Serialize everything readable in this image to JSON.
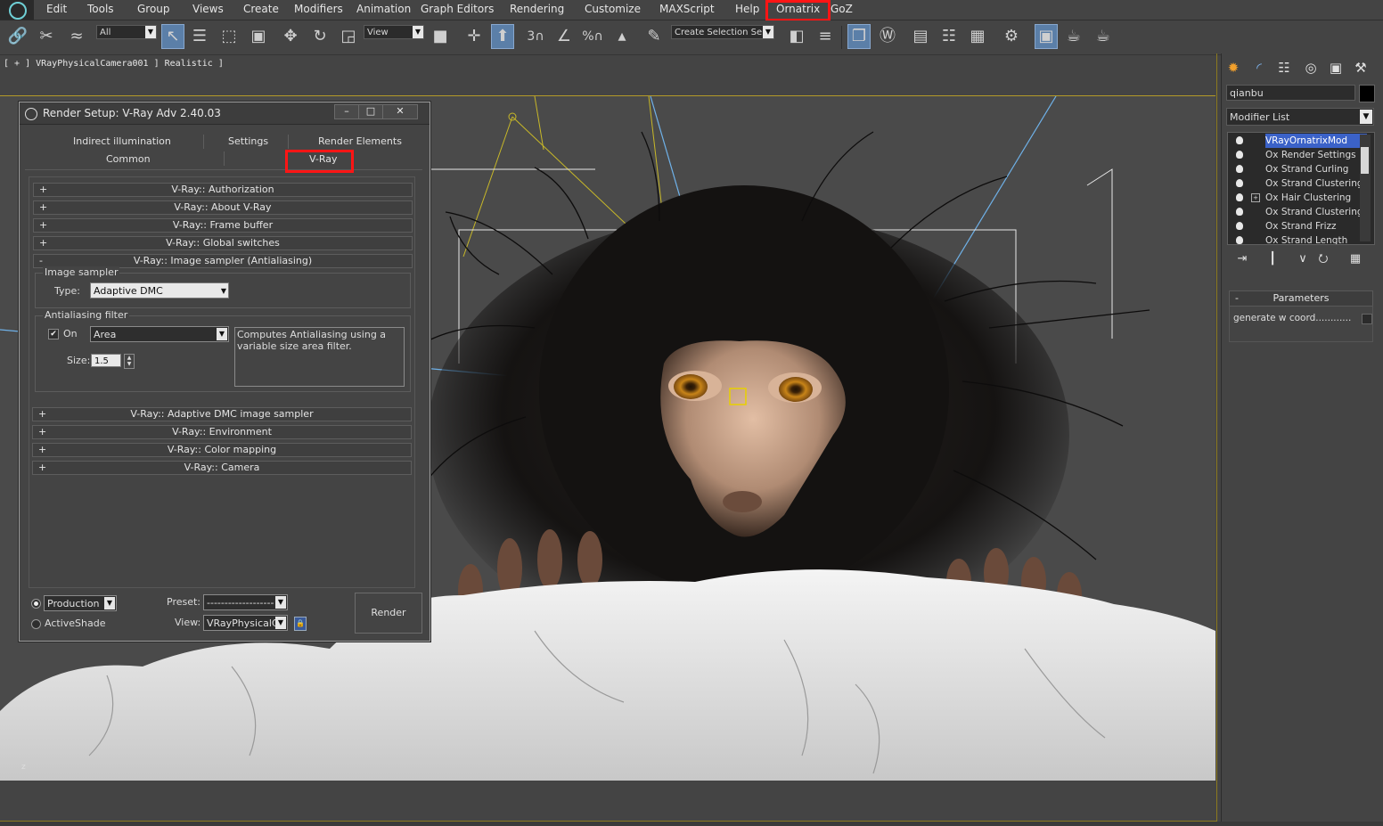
{
  "menubar": {
    "items": [
      "Edit",
      "Tools",
      "Group",
      "Views",
      "Create",
      "Modifiers",
      "Animation",
      "Graph Editors",
      "Rendering",
      "Customize",
      "MAXScript",
      "Help",
      "Ornatrix",
      "GoZ"
    ]
  },
  "toolbar": {
    "selection_filter": "All",
    "reference_coord": "View",
    "named_selection_placeholder": "Create Selection Se",
    "snap_label": "3",
    "percent_label": "%"
  },
  "viewport": {
    "label": "[ + ] VRayPhysicalCamera001 ] Realistic ]",
    "axis_label": "z"
  },
  "command_panel": {
    "object_name": "qianbu",
    "modifier_list_label": "Modifier List",
    "modifiers": [
      {
        "name": "VRayOrnatrixMod",
        "selected": true,
        "expandable": false
      },
      {
        "name": "Ox Render Settings",
        "selected": false,
        "expandable": false
      },
      {
        "name": "Ox Strand Curling",
        "selected": false,
        "expandable": false
      },
      {
        "name": "Ox Strand Clustering",
        "selected": false,
        "expandable": false
      },
      {
        "name": "Ox Hair Clustering",
        "selected": false,
        "expandable": true
      },
      {
        "name": "Ox Strand Clustering",
        "selected": false,
        "expandable": false
      },
      {
        "name": "Ox Strand Frizz",
        "selected": false,
        "expandable": false
      },
      {
        "name": "Ox Strand Length",
        "selected": false,
        "expandable": false
      }
    ],
    "parameters_title": "Parameters",
    "parameters_minus": "-",
    "generate_w_label": "generate w coord............"
  },
  "render_setup": {
    "title": "Render Setup: V-Ray Adv 2.40.03",
    "window_buttons": {
      "minimize": "–",
      "maximize": "□",
      "close": "✕"
    },
    "tabs_row1": [
      "Indirect illumination",
      "Settings",
      "Render Elements"
    ],
    "tabs_row2": [
      "Common",
      "V-Ray"
    ],
    "rollouts_top": [
      {
        "sign": "+",
        "label": "V-Ray:: Authorization"
      },
      {
        "sign": "+",
        "label": "V-Ray:: About V-Ray"
      },
      {
        "sign": "+",
        "label": "V-Ray:: Frame buffer"
      },
      {
        "sign": "+",
        "label": "V-Ray:: Global switches"
      },
      {
        "sign": "-",
        "label": "V-Ray:: Image sampler (Antialiasing)"
      }
    ],
    "image_sampler": {
      "group_title": "Image sampler",
      "type_label": "Type:",
      "type_value": "Adaptive DMC"
    },
    "aa_filter": {
      "group_title": "Antialiasing filter",
      "on_label": "On",
      "on_checked": "✔",
      "filter_value": "Area",
      "description": "Computes Antialiasing using a variable size area filter.",
      "size_label": "Size:",
      "size_value": "1.5"
    },
    "rollouts_bottom": [
      {
        "sign": "+",
        "label": "V-Ray:: Adaptive DMC image sampler"
      },
      {
        "sign": "+",
        "label": "V-Ray:: Environment"
      },
      {
        "sign": "+",
        "label": "V-Ray:: Color mapping"
      },
      {
        "sign": "+",
        "label": "V-Ray:: Camera"
      }
    ],
    "footer": {
      "mode_value": "Production",
      "activeshade_label": "ActiveShade",
      "preset_label": "Preset:",
      "preset_value": "-------------------",
      "view_label": "View:",
      "view_value": "VRayPhysicalCa",
      "render_label": "Render"
    }
  },
  "colors": {
    "highlight": "#ff1515",
    "selected_modifier": "#3b62c8",
    "viewport_border": "#b49a28"
  }
}
